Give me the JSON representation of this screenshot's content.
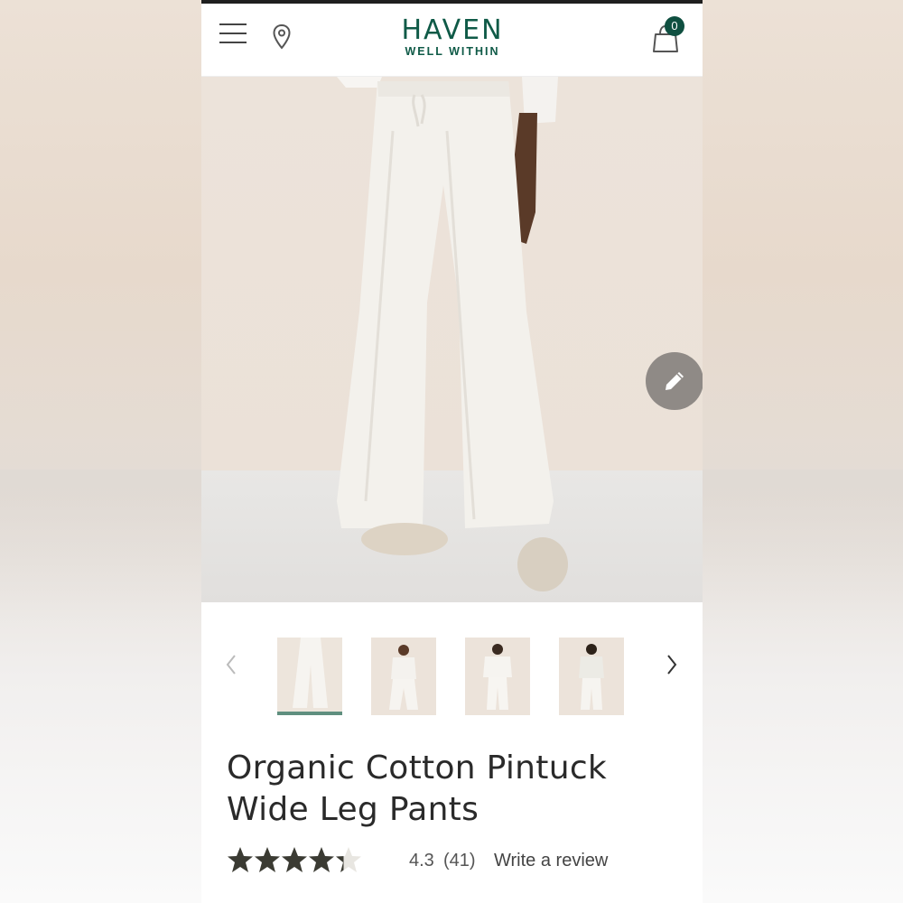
{
  "header": {
    "logo_main": "HAVEN",
    "logo_sub": "WELL WITHIN",
    "cart_count": "0"
  },
  "colors": {
    "brand_green": "#0f5a47",
    "badge_green": "#0f4f40",
    "thumb_active": "#5f8f7f",
    "star": "#3b3b33"
  },
  "icons": {
    "menu": "hamburger-menu-icon",
    "location": "map-pin-icon",
    "cart": "shopping-bag-icon",
    "edit": "pencil-icon",
    "prev": "chevron-left-icon",
    "next": "chevron-right-icon",
    "stars": "star-icon"
  },
  "gallery": {
    "thumbnails": [
      {
        "label": "Pants front view",
        "active": true
      },
      {
        "label": "Full outfit front"
      },
      {
        "label": "Full outfit front alt"
      },
      {
        "label": "Full outfit side"
      }
    ]
  },
  "product": {
    "title": "Organic Cotton Pintuck Wide Leg Pants",
    "rating": "4.3",
    "rating_value": 4.3,
    "rating_max": 5,
    "review_count": "(41)",
    "write_review": "Write a review"
  }
}
